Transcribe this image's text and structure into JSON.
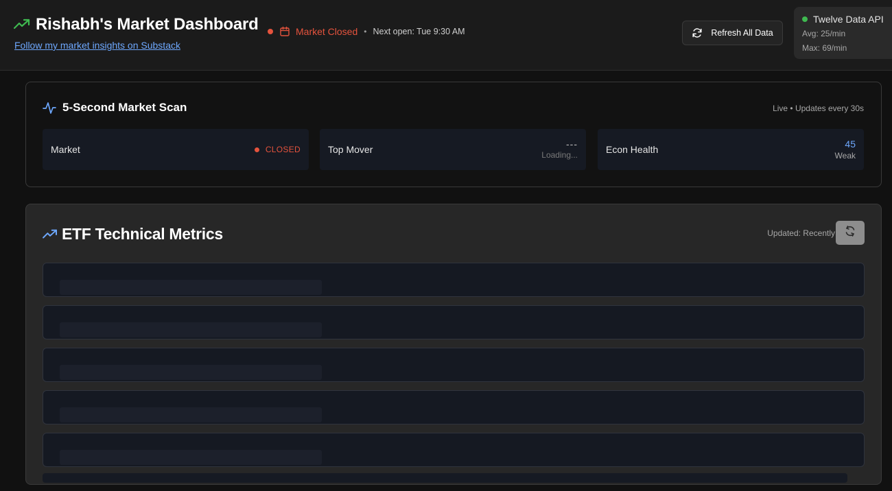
{
  "header": {
    "title": "Rishabh's Market Dashboard",
    "substack_link": "Follow my market insights on Substack",
    "market_status": "Market Closed",
    "separator": "•",
    "next_open": "Next open: Tue 9:30 AM",
    "refresh_label": "Refresh All Data",
    "api": {
      "name": "Twelve Data API",
      "avg": "Avg: 25/min",
      "max": "Max: 69/min",
      "status_color": "#3fb950"
    }
  },
  "scan": {
    "title": "5-Second Market Scan",
    "live_text": "Live • Updates every 30s",
    "cards": [
      {
        "label": "Market",
        "value": "CLOSED",
        "value_color": "#e5533d"
      },
      {
        "label": "Top Mover",
        "value": "---",
        "sub": "Loading..."
      },
      {
        "label": "Econ Health",
        "value": "45",
        "sub": "Weak",
        "value_color": "#6ea8fe"
      }
    ]
  },
  "etf": {
    "title": "ETF Technical Metrics",
    "updated": "Updated: Recently",
    "skeleton_rows": 5
  },
  "colors": {
    "accent_blue": "#6ea8fe",
    "accent_green": "#3fb950",
    "status_red": "#e5533d",
    "background": "#111111"
  },
  "icons": [
    "trending-up-icon",
    "calendar-icon",
    "refresh-icon",
    "activity-pulse-icon",
    "refresh-cw-icon"
  ]
}
